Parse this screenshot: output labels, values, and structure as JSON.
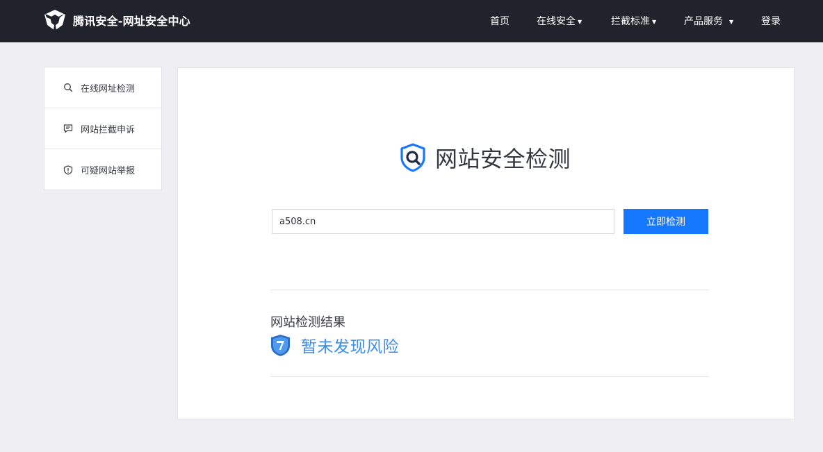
{
  "header": {
    "brand_title": "腾讯安全-网址安全中心",
    "brand_logo_icon": "tencent-security-logo-icon",
    "nav": [
      {
        "label": "首页",
        "has_dropdown": false
      },
      {
        "label": "在线安全",
        "has_dropdown": true
      },
      {
        "label": "拦截标准",
        "has_dropdown": true
      },
      {
        "label": "产品服务",
        "has_dropdown": true
      },
      {
        "label": "登录",
        "has_dropdown": false
      }
    ],
    "caret": "▼"
  },
  "sidebar": {
    "items": [
      {
        "label": "在线网址检测",
        "icon": "search-icon"
      },
      {
        "label": "网站拦截申诉",
        "icon": "chat-bubble-icon"
      },
      {
        "label": "可疑网站举报",
        "icon": "shield-alert-icon"
      }
    ]
  },
  "main": {
    "title": "网站安全检测",
    "title_icon": "shield-search-icon",
    "search": {
      "value": "a508.cn",
      "button_label": "立即检测"
    },
    "result": {
      "heading": "网站检测结果",
      "status": "暂未发现风险",
      "status_icon": "safe-shield-icon"
    }
  },
  "colors": {
    "header_bg": "#20232c",
    "page_bg": "#efeff3",
    "accent": "#1677ff",
    "safe_text": "#3b8ef0"
  }
}
